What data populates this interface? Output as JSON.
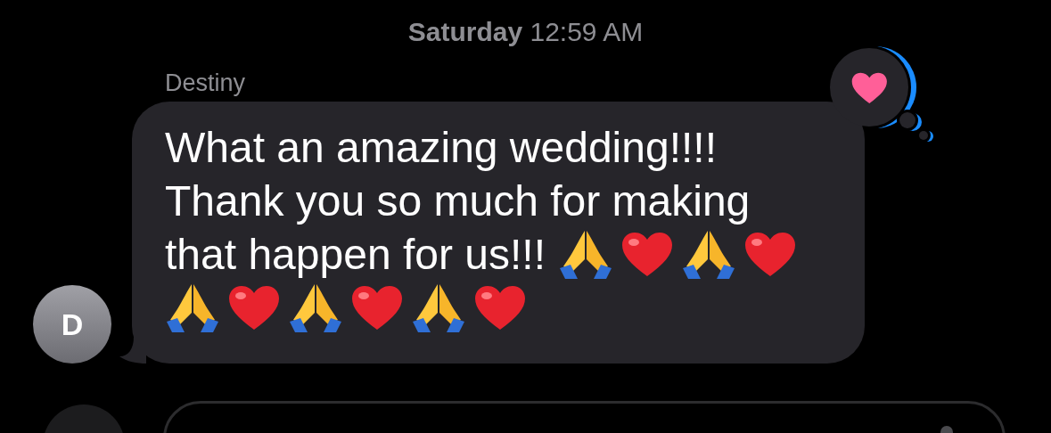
{
  "timestamp": {
    "day": "Saturday",
    "time": "12:59 AM"
  },
  "messages": [
    {
      "sender": "Destiny",
      "avatar_initial": "D",
      "lines": [
        {
          "text": "What an amazing wedding!!!!"
        },
        {
          "text": "Thank you so much for making"
        },
        {
          "text": "that happen for us!!!",
          "emoji": [
            {
              "kind": "pray"
            },
            {
              "kind": "heart"
            },
            {
              "kind": "pray"
            },
            {
              "kind": "heart"
            }
          ]
        },
        {
          "emoji": [
            {
              "kind": "pray"
            },
            {
              "kind": "heart"
            },
            {
              "kind": "pray"
            },
            {
              "kind": "heart"
            },
            {
              "kind": "pray"
            },
            {
              "kind": "heart"
            }
          ]
        }
      ],
      "tapback": {
        "kind": "heart"
      }
    }
  ]
}
